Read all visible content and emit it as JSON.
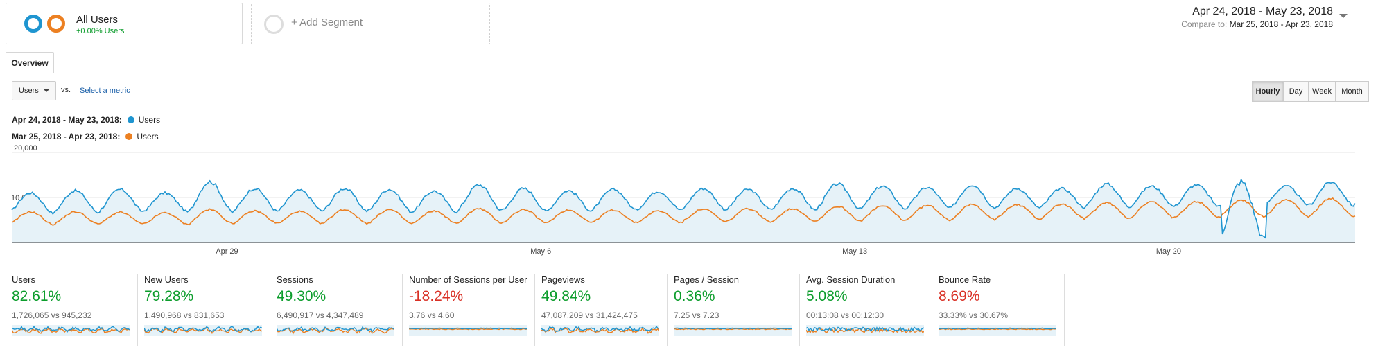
{
  "segments": {
    "active": {
      "title": "All Users",
      "subtitle": "+0.00% Users"
    },
    "add_label": "+ Add Segment"
  },
  "date_range": {
    "main": "Apr 24, 2018 - May 23, 2018",
    "compare_label": "Compare to:",
    "compare_value": "Mar 25, 2018 - Apr 23, 2018"
  },
  "tabs": [
    {
      "label": "Overview"
    }
  ],
  "metric_selector": {
    "metric": "Users",
    "vs": "vs.",
    "select_label": "Select a metric"
  },
  "granularity": [
    {
      "label": "Hourly",
      "active": true
    },
    {
      "label": "Day",
      "active": false
    },
    {
      "label": "Week",
      "active": false
    },
    {
      "label": "Month",
      "active": false
    }
  ],
  "legend": [
    {
      "range": "Apr 24, 2018 - May 23, 2018:",
      "series": "Users",
      "color": "#1f95d0"
    },
    {
      "range": "Mar 25, 2018 - Apr 23, 2018:",
      "series": "Users",
      "color": "#ec8022"
    }
  ],
  "colors": {
    "current": "#1f95d0",
    "previous": "#ec8022",
    "fill": "#e6f2f8",
    "positive": "#0c9d2c",
    "negative": "#d93025"
  },
  "chart_data": {
    "type": "line",
    "y_ticks": [
      "20,000",
      "10,000"
    ],
    "ylim": [
      0,
      20000
    ],
    "x_ticks": [
      "Apr 29",
      "May 6",
      "May 13",
      "May 20"
    ],
    "x_range_hours": 720,
    "grid": true,
    "series": [
      {
        "name": "Users",
        "period": "Apr 24, 2018 - May 23, 2018",
        "color": "#1f95d0",
        "daily_peaks": [
          11000,
          11500,
          11800,
          11000,
          13500,
          12000,
          11600,
          12000,
          11800,
          11400,
          12800,
          12000,
          11500,
          11800,
          11300,
          12000,
          11800,
          12000,
          13000,
          12500,
          12200,
          12800,
          12000,
          12000,
          13000,
          12500,
          12800,
          13500,
          12500,
          13400
        ],
        "daily_troughs": [
          6500,
          6700,
          6900,
          6800,
          6700,
          6900,
          7000,
          7000,
          6800,
          6800,
          7100,
          6900,
          7000,
          7200,
          7200,
          7300,
          7300,
          7200,
          7400,
          7500,
          7600,
          7700,
          7700,
          7800,
          7900,
          8000,
          8000,
          800,
          8300,
          8200
        ]
      },
      {
        "name": "Users",
        "period": "Mar 25, 2018 - Apr 23, 2018",
        "color": "#ec8022",
        "daily_peaks": [
          6800,
          6800,
          6700,
          6600,
          7300,
          7000,
          6900,
          7300,
          7300,
          7000,
          7500,
          7300,
          7200,
          7200,
          7000,
          7400,
          7500,
          7500,
          8000,
          8100,
          8200,
          8400,
          8400,
          8500,
          8800,
          9000,
          9100,
          9400,
          9500,
          9700
        ],
        "daily_troughs": [
          4000,
          4100,
          4100,
          4000,
          4200,
          4300,
          4200,
          4300,
          4200,
          4200,
          4400,
          4300,
          4500,
          4400,
          4400,
          4600,
          4500,
          4700,
          4800,
          4900,
          5000,
          5100,
          5200,
          5300,
          5400,
          5500,
          5600,
          5700,
          5800,
          5900
        ]
      }
    ]
  },
  "scorecards": [
    {
      "name": "Users",
      "change": "82.61%",
      "trend": "positive",
      "values": "1,726,065 vs 945,232",
      "spark": "volatile"
    },
    {
      "name": "New Users",
      "change": "79.28%",
      "trend": "positive",
      "values": "1,490,968 vs 831,653",
      "spark": "volatile"
    },
    {
      "name": "Sessions",
      "change": "49.30%",
      "trend": "positive",
      "values": "6,490,917 vs 4,347,489",
      "spark": "volatile"
    },
    {
      "name": "Number of Sessions per User",
      "change": "-18.24%",
      "trend": "negative",
      "values": "3.76 vs 4.60",
      "spark": "flat"
    },
    {
      "name": "Pageviews",
      "change": "49.84%",
      "trend": "positive",
      "values": "47,087,209 vs 31,424,475",
      "spark": "volatile"
    },
    {
      "name": "Pages / Session",
      "change": "0.36%",
      "trend": "positive",
      "values": "7.25 vs 7.23",
      "spark": "flat"
    },
    {
      "name": "Avg. Session Duration",
      "change": "5.08%",
      "trend": "positive",
      "values": "00:13:08 vs 00:12:30",
      "spark": "dense"
    },
    {
      "name": "Bounce Rate",
      "change": "8.69%",
      "trend": "negative",
      "values": "33.33% vs 30.67%",
      "spark": "flat"
    }
  ]
}
